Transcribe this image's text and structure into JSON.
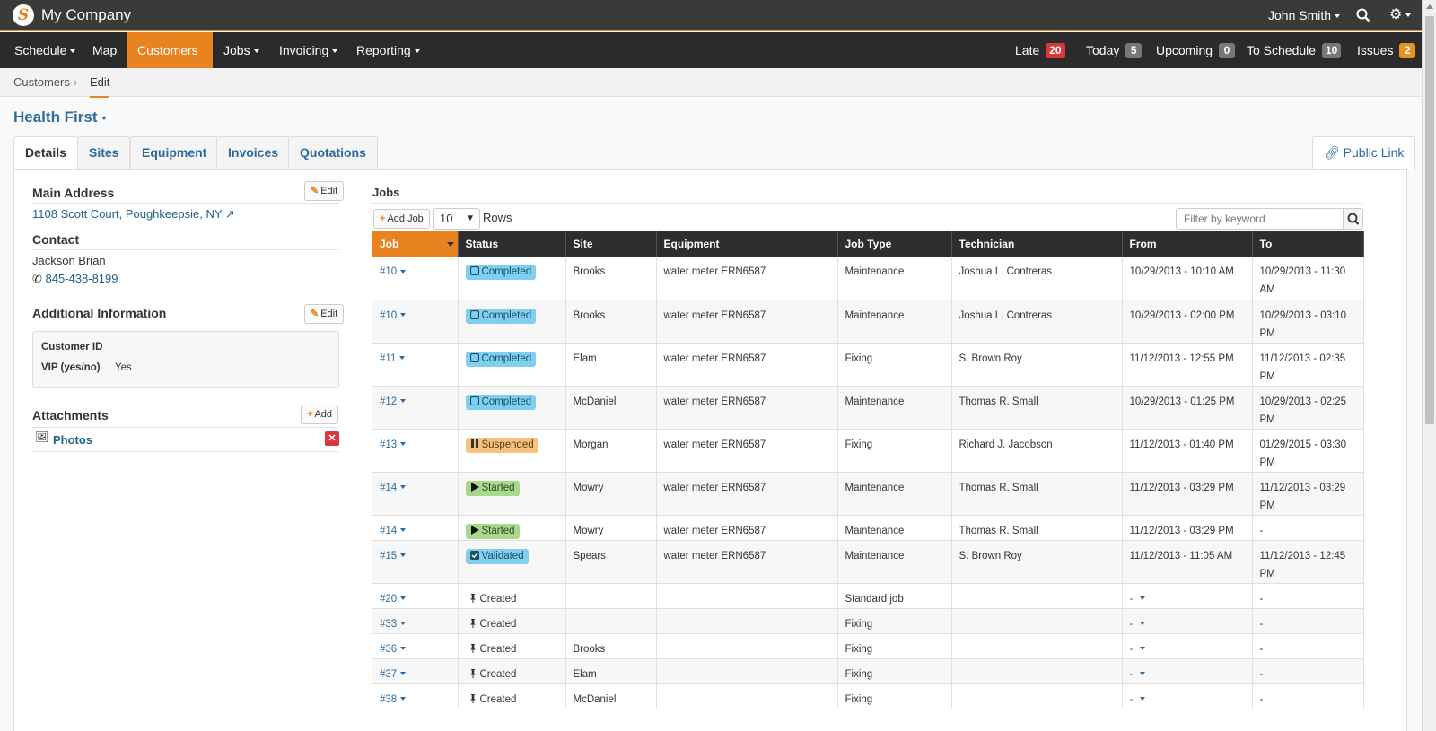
{
  "app": {
    "title": "My Company",
    "logo_letter": "S",
    "user_name": "John Smith"
  },
  "nav": {
    "items": [
      {
        "label": "Schedule",
        "dropdown": true
      },
      {
        "label": "Map",
        "dropdown": false
      },
      {
        "label": "Customers",
        "dropdown": true,
        "active": true
      },
      {
        "label": "Jobs",
        "dropdown": true
      },
      {
        "label": "Invoicing",
        "dropdown": true
      },
      {
        "label": "Reporting",
        "dropdown": true
      }
    ],
    "counters": [
      {
        "label": "Late",
        "count": "20",
        "color": "#d9363e"
      },
      {
        "label": "Today",
        "count": "5",
        "color": "#777777"
      },
      {
        "label": "Upcoming",
        "count": "0",
        "color": "#777777"
      },
      {
        "label": "To Schedule",
        "count": "10",
        "color": "#777777"
      },
      {
        "label": "Issues",
        "count": "2",
        "color": "#e8931f"
      }
    ]
  },
  "breadcrumb": {
    "parent": "Customers",
    "current": "Edit"
  },
  "customer": {
    "name": "Health First"
  },
  "tabs": [
    "Details",
    "Sites",
    "Equipment",
    "Invoices",
    "Quotations"
  ],
  "public_link": "Public Link",
  "details": {
    "main_address_title": "Main Address",
    "edit_label": "Edit",
    "address": "1108 Scott Court, Poughkeepsie, NY",
    "contact_title": "Contact",
    "contact_name": "Jackson Brian",
    "contact_phone": "845-438-8199",
    "additional_title": "Additional Information",
    "customer_id_label": "Customer ID",
    "vip_label": "VIP (yes/no)",
    "vip_value": "Yes",
    "attachments_title": "Attachments",
    "add_label": "Add",
    "attachment_name": "Photos"
  },
  "jobs": {
    "title": "Jobs",
    "add_job_label": "Add Job",
    "rows_value": "10",
    "rows_label": "Rows",
    "filter_placeholder": "Filter by keyword",
    "columns": [
      "Job",
      "Status",
      "Site",
      "Equipment",
      "Job Type",
      "Technician",
      "From",
      "To"
    ],
    "rows": [
      {
        "job": "#10",
        "status": "Completed",
        "site": "Brooks",
        "equipment": "water meter ERN6587",
        "type": "Maintenance",
        "tech": "Joshua L. Contreras",
        "from": "10/29/2013 - 10:10 AM",
        "to": "10/29/2013 - 11:30 AM"
      },
      {
        "job": "#10",
        "status": "Completed",
        "site": "Brooks",
        "equipment": "water meter ERN6587",
        "type": "Maintenance",
        "tech": "Joshua L. Contreras",
        "from": "10/29/2013 - 02:00 PM",
        "to": "10/29/2013 - 03:10 PM"
      },
      {
        "job": "#11",
        "status": "Completed",
        "site": "Elam",
        "equipment": "water meter ERN6587",
        "type": "Fixing",
        "tech": "S. Brown Roy",
        "from": "11/12/2013 - 12:55 PM",
        "to": "11/12/2013 - 02:35 PM"
      },
      {
        "job": "#12",
        "status": "Completed",
        "site": "McDaniel",
        "equipment": "water meter ERN6587",
        "type": "Maintenance",
        "tech": "Thomas R. Small",
        "from": "10/29/2013 - 01:25 PM",
        "to": "10/29/2013 - 02:25 PM"
      },
      {
        "job": "#13",
        "status": "Suspended",
        "site": "Morgan",
        "equipment": "water meter ERN6587",
        "type": "Fixing",
        "tech": "Richard J. Jacobson",
        "from": "11/12/2013 - 01:40 PM",
        "to": "01/29/2015 - 03:30 PM"
      },
      {
        "job": "#14",
        "status": "Started",
        "site": "Mowry",
        "equipment": "water meter ERN6587",
        "type": "Maintenance",
        "tech": "Thomas R. Small",
        "from": "11/12/2013 - 03:29 PM",
        "to": "11/12/2013 - 03:29 PM"
      },
      {
        "job": "#14",
        "status": "Started",
        "site": "Mowry",
        "equipment": "water meter ERN6587",
        "type": "Maintenance",
        "tech": "Thomas R. Small",
        "from": "11/12/2013 - 03:29 PM",
        "to": "-"
      },
      {
        "job": "#15",
        "status": "Validated",
        "site": "Spears",
        "equipment": "water meter ERN6587",
        "type": "Maintenance",
        "tech": "S. Brown Roy",
        "from": "11/12/2013 - 11:05 AM",
        "to": "11/12/2013 - 12:45 PM"
      },
      {
        "job": "#20",
        "status": "Created",
        "site": "",
        "equipment": "",
        "type": "Standard job",
        "tech": "",
        "from": "-",
        "to": "-"
      },
      {
        "job": "#33",
        "status": "Created",
        "site": "",
        "equipment": "",
        "type": "Fixing",
        "tech": "",
        "from": "-",
        "to": "-"
      },
      {
        "job": "#36",
        "status": "Created",
        "site": "Brooks",
        "equipment": "",
        "type": "Fixing",
        "tech": "",
        "from": "-",
        "to": "-"
      },
      {
        "job": "#37",
        "status": "Created",
        "site": "Elam",
        "equipment": "",
        "type": "Fixing",
        "tech": "",
        "from": "-",
        "to": "-"
      },
      {
        "job": "#38",
        "status": "Created",
        "site": "McDaniel",
        "equipment": "",
        "type": "Fixing",
        "tech": "",
        "from": "-",
        "to": "-"
      }
    ]
  }
}
